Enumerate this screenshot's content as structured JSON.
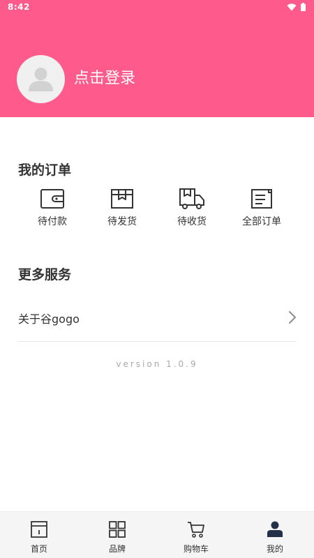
{
  "status_bar": {
    "time": "8:42",
    "icons": [
      "wifi-icon",
      "battery-icon"
    ]
  },
  "header": {
    "login_text": "点击登录",
    "background_color": "#fe5a8b"
  },
  "orders": {
    "title": "我的订单",
    "items": [
      {
        "label": "待付款",
        "icon": "wallet-icon"
      },
      {
        "label": "待发货",
        "icon": "box-icon"
      },
      {
        "label": "待收货",
        "icon": "delivery-truck-icon"
      },
      {
        "label": "全部订单",
        "icon": "order-list-icon"
      }
    ]
  },
  "services": {
    "title": "更多服务",
    "items": [
      {
        "label": "关于谷gogo",
        "icon": "chevron-right-icon"
      }
    ]
  },
  "version_text": "version 1.0.9",
  "bottom_nav": {
    "items": [
      {
        "label": "首页",
        "icon": "home-icon"
      },
      {
        "label": "品牌",
        "icon": "grid-icon"
      },
      {
        "label": "购物车",
        "icon": "cart-icon"
      },
      {
        "label": "我的",
        "icon": "user-icon",
        "active": true
      }
    ]
  }
}
